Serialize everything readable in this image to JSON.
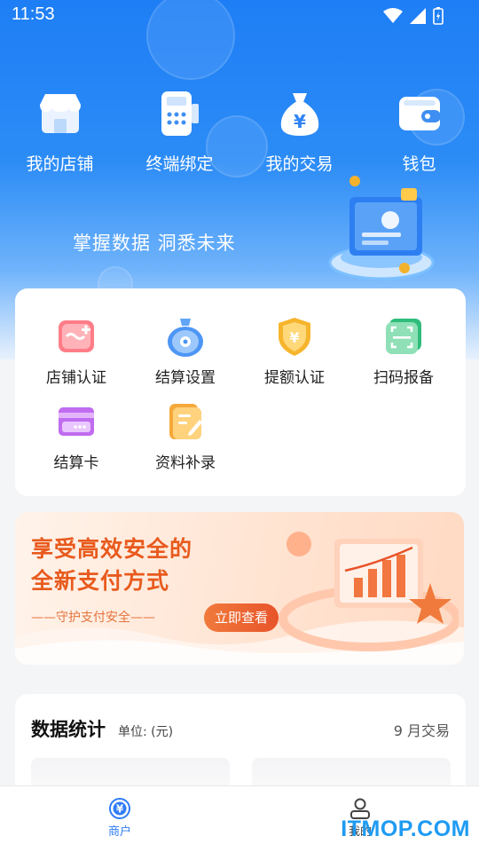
{
  "status_bar": {
    "time": "11:53"
  },
  "top_nav": [
    {
      "label": "我的店铺",
      "icon": "store-icon"
    },
    {
      "label": "终端绑定",
      "icon": "pos-terminal-icon"
    },
    {
      "label": "我的交易",
      "icon": "money-bag-icon"
    },
    {
      "label": "钱包",
      "icon": "wallet-icon"
    }
  ],
  "hero": {
    "slogan": "掌握数据 洞悉未来"
  },
  "services": [
    {
      "label": "店铺认证",
      "icon": "store-cert-icon"
    },
    {
      "label": "结算设置",
      "icon": "settlement-settings-icon"
    },
    {
      "label": "提额认证",
      "icon": "limit-cert-shield-icon"
    },
    {
      "label": "扫码报备",
      "icon": "scan-code-icon"
    },
    {
      "label": "结算卡",
      "icon": "bank-card-icon"
    },
    {
      "label": "资料补录",
      "icon": "document-edit-icon"
    }
  ],
  "banner": {
    "line1": "享受高效安全的",
    "line2": "全新支付方式",
    "tagline": "——守护支付安全——",
    "button": "立即查看"
  },
  "stats": {
    "title": "数据统计",
    "unit": "单位: (元)",
    "period": "9 月交易"
  },
  "tabbar": [
    {
      "label": "商户",
      "icon": "merchant-icon",
      "active": true
    },
    {
      "label": "我的",
      "icon": "profile-icon",
      "active": false
    }
  ],
  "watermark": "ITMOP.COM",
  "colors": {
    "primary": "#1e7ef5",
    "tab_active": "#2f7cf6",
    "banner_text": "#e85a1d"
  }
}
